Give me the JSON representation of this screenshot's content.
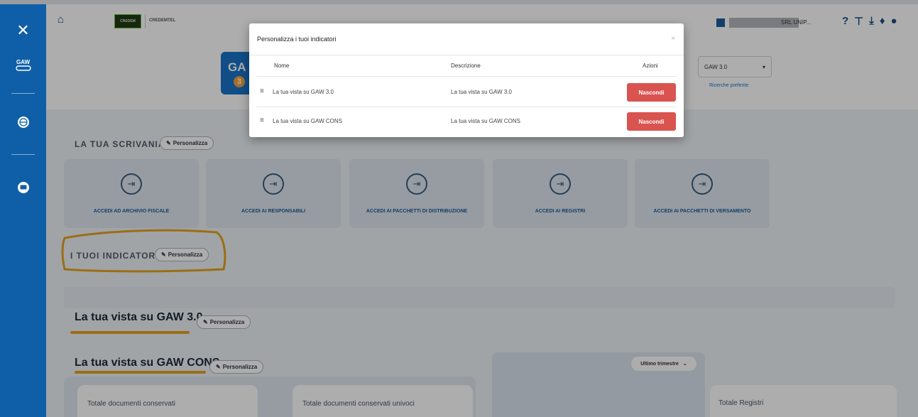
{
  "header": {
    "brand_badge": "CREDEM",
    "brand_name": "CREDEMTEL",
    "logo_text": "GA",
    "logo_sub": "3",
    "company": "SRL UNIP...",
    "select_value": "GAW 3.0",
    "saved_searches": "Ricerche preferite"
  },
  "sidebar": {
    "logo": "GAW"
  },
  "desk": {
    "title": "LA TUA SCRIVANIA",
    "customize": "Personalizza",
    "tiles": [
      {
        "label": "ACCEDI AD ARCHIVIO FISCALE"
      },
      {
        "label": "ACCEDI AI RESPONSABILI"
      },
      {
        "label": "ACCEDI AI PACCHETTI DI DISTRIBUZIONE"
      },
      {
        "label": "ACCEDI AI REGISTRI"
      },
      {
        "label": "ACCEDI AI PACCHETTI DI VERSAMENTO"
      }
    ]
  },
  "indicators": {
    "title": "I TUOI INDICATORI",
    "customize": "Personalizza"
  },
  "views": [
    {
      "title": "La tua vista su GAW 3.0",
      "customize": "Personalizza"
    },
    {
      "title": "La tua vista su GAW CONS",
      "customize": "Personalizza"
    }
  ],
  "period_select": "Ultimo trimestre",
  "cards": [
    {
      "label": "Totale documenti conservati"
    },
    {
      "label": "Totale documenti conservati univoci"
    },
    {
      "label": "Totale Registri"
    }
  ],
  "modal": {
    "title": "Personalizza i tuoi indicatori",
    "close": "×",
    "columns": {
      "name": "Nome",
      "description": "Descrizione",
      "actions": "Azioni"
    },
    "rows": [
      {
        "name": "La tua vista su GAW 3.0",
        "description": "La tua vista su GAW 3.0",
        "action": "Nascondi"
      },
      {
        "name": "La tua vista su GAW CONS",
        "description": "La tua vista su GAW CONS",
        "action": "Nascondi"
      }
    ]
  },
  "colors": {
    "sidebar": "#0f5fa8",
    "danger": "#d9534f",
    "highlight": "#e3a31f"
  }
}
